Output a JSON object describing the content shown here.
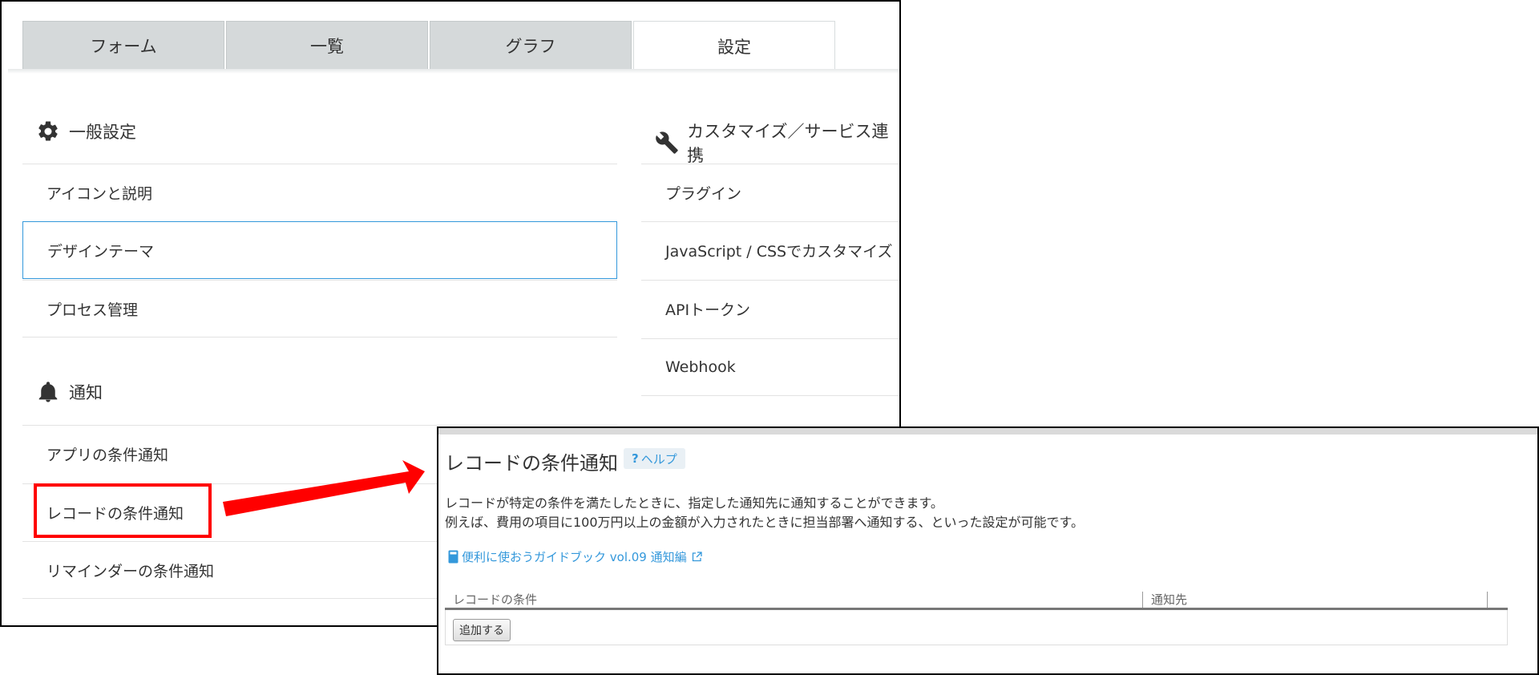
{
  "tabs": [
    "フォーム",
    "一覧",
    "グラフ",
    "設定"
  ],
  "general": {
    "title": "一般設定",
    "items": [
      "アイコンと説明",
      "デザインテーマ",
      "プロセス管理"
    ]
  },
  "notify": {
    "title": "通知",
    "items": [
      "アプリの条件通知",
      "レコードの条件通知",
      "リマインダーの条件通知"
    ]
  },
  "customize": {
    "title": "カスタマイズ／サービス連携",
    "items": [
      "プラグイン",
      "JavaScript / CSSでカスタマイズ",
      "APIトークン",
      "Webhook"
    ]
  },
  "record_notify": {
    "title": "レコードの条件通知",
    "help_mark": "?",
    "help_label": "ヘルプ",
    "desc1": "レコードが特定の条件を満たしたときに、指定した通知先に通知することができます。",
    "desc2": "例えば、費用の項目に100万円以上の金額が入力されたときに担当部署へ通知する、といった設定が可能です。",
    "guide_link": "便利に使おうガイドブック vol.09 通知編",
    "col_condition": "レコードの条件",
    "col_target": "通知先",
    "add_button": "追加する"
  },
  "colors": {
    "accent": "#3498db",
    "highlight": "#ff0000",
    "tab_inactive": "#d5d9da"
  }
}
